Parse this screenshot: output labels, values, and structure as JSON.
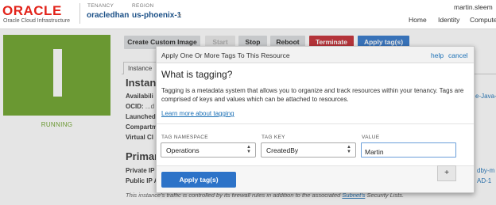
{
  "header": {
    "logo_word": "ORACLE",
    "logo_sub": "Oracle Cloud Infrastructure",
    "tenancy_label": "TENANCY",
    "tenancy_value": "oracledhan",
    "region_label": "REGION",
    "region_value": "us-phoenix-1",
    "user": "martin.sleem",
    "nav": [
      "Home",
      "Identity",
      "Compute"
    ]
  },
  "instance": {
    "status": "RUNNING",
    "status_color": "#6aa125"
  },
  "actions": {
    "create_image": "Create Custom Image",
    "start": "Start",
    "stop": "Stop",
    "reboot": "Reboot",
    "terminate": "Terminate",
    "apply_tags": "Apply tag(s)"
  },
  "background": {
    "tab": "Instance",
    "section_instance": "Instance",
    "labels": [
      "Availabili",
      "OCID:",
      "Launched",
      "Compartm",
      "Virtual Cl"
    ],
    "ocid_value": "...d",
    "section_primary": "Primar",
    "primary_labels": [
      "Private IP",
      "Public IP A"
    ],
    "right_links": [
      "e-Java-B",
      "dby-m",
      "AD-1"
    ],
    "footnote_pre": "This instance's traffic is controlled by its firewall rules in addition to the associated ",
    "footnote_link": "Subnet's",
    "footnote_post": " Security Lists."
  },
  "modal": {
    "title": "Apply One Or More Tags To This Resource",
    "help": "help",
    "cancel": "cancel",
    "heading": "What is tagging?",
    "description": "Tagging is a metadata system that allows you to organize and track resources within your tenancy. Tags are comprised of keys and values which can be attached to resources.",
    "learn_more": "Learn more about tagging",
    "tag_namespace_label": "TAG NAMESPACE",
    "tag_key_label": "TAG KEY",
    "value_label": "VALUE",
    "tag_namespace_value": "Operations",
    "tag_key_value": "CreatedBy",
    "value_value": "Martin",
    "apply_button": "Apply tag(s)",
    "add_button": "+"
  },
  "colors": {
    "accent": "#2d73c8",
    "danger": "#c2262e",
    "brand_red": "#e2231a",
    "link": "#1a6fb5"
  }
}
